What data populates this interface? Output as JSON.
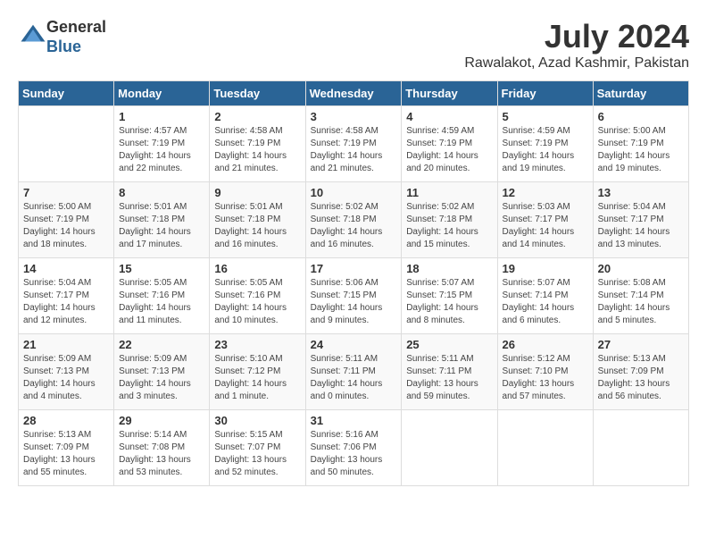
{
  "logo": {
    "general": "General",
    "blue": "Blue"
  },
  "title": "July 2024",
  "location": "Rawalakot, Azad Kashmir, Pakistan",
  "days_of_week": [
    "Sunday",
    "Monday",
    "Tuesday",
    "Wednesday",
    "Thursday",
    "Friday",
    "Saturday"
  ],
  "weeks": [
    [
      {
        "day": "",
        "info": ""
      },
      {
        "day": "1",
        "info": "Sunrise: 4:57 AM\nSunset: 7:19 PM\nDaylight: 14 hours\nand 22 minutes."
      },
      {
        "day": "2",
        "info": "Sunrise: 4:58 AM\nSunset: 7:19 PM\nDaylight: 14 hours\nand 21 minutes."
      },
      {
        "day": "3",
        "info": "Sunrise: 4:58 AM\nSunset: 7:19 PM\nDaylight: 14 hours\nand 21 minutes."
      },
      {
        "day": "4",
        "info": "Sunrise: 4:59 AM\nSunset: 7:19 PM\nDaylight: 14 hours\nand 20 minutes."
      },
      {
        "day": "5",
        "info": "Sunrise: 4:59 AM\nSunset: 7:19 PM\nDaylight: 14 hours\nand 19 minutes."
      },
      {
        "day": "6",
        "info": "Sunrise: 5:00 AM\nSunset: 7:19 PM\nDaylight: 14 hours\nand 19 minutes."
      }
    ],
    [
      {
        "day": "7",
        "info": "Sunrise: 5:00 AM\nSunset: 7:19 PM\nDaylight: 14 hours\nand 18 minutes."
      },
      {
        "day": "8",
        "info": "Sunrise: 5:01 AM\nSunset: 7:18 PM\nDaylight: 14 hours\nand 17 minutes."
      },
      {
        "day": "9",
        "info": "Sunrise: 5:01 AM\nSunset: 7:18 PM\nDaylight: 14 hours\nand 16 minutes."
      },
      {
        "day": "10",
        "info": "Sunrise: 5:02 AM\nSunset: 7:18 PM\nDaylight: 14 hours\nand 16 minutes."
      },
      {
        "day": "11",
        "info": "Sunrise: 5:02 AM\nSunset: 7:18 PM\nDaylight: 14 hours\nand 15 minutes."
      },
      {
        "day": "12",
        "info": "Sunrise: 5:03 AM\nSunset: 7:17 PM\nDaylight: 14 hours\nand 14 minutes."
      },
      {
        "day": "13",
        "info": "Sunrise: 5:04 AM\nSunset: 7:17 PM\nDaylight: 14 hours\nand 13 minutes."
      }
    ],
    [
      {
        "day": "14",
        "info": "Sunrise: 5:04 AM\nSunset: 7:17 PM\nDaylight: 14 hours\nand 12 minutes."
      },
      {
        "day": "15",
        "info": "Sunrise: 5:05 AM\nSunset: 7:16 PM\nDaylight: 14 hours\nand 11 minutes."
      },
      {
        "day": "16",
        "info": "Sunrise: 5:05 AM\nSunset: 7:16 PM\nDaylight: 14 hours\nand 10 minutes."
      },
      {
        "day": "17",
        "info": "Sunrise: 5:06 AM\nSunset: 7:15 PM\nDaylight: 14 hours\nand 9 minutes."
      },
      {
        "day": "18",
        "info": "Sunrise: 5:07 AM\nSunset: 7:15 PM\nDaylight: 14 hours\nand 8 minutes."
      },
      {
        "day": "19",
        "info": "Sunrise: 5:07 AM\nSunset: 7:14 PM\nDaylight: 14 hours\nand 6 minutes."
      },
      {
        "day": "20",
        "info": "Sunrise: 5:08 AM\nSunset: 7:14 PM\nDaylight: 14 hours\nand 5 minutes."
      }
    ],
    [
      {
        "day": "21",
        "info": "Sunrise: 5:09 AM\nSunset: 7:13 PM\nDaylight: 14 hours\nand 4 minutes."
      },
      {
        "day": "22",
        "info": "Sunrise: 5:09 AM\nSunset: 7:13 PM\nDaylight: 14 hours\nand 3 minutes."
      },
      {
        "day": "23",
        "info": "Sunrise: 5:10 AM\nSunset: 7:12 PM\nDaylight: 14 hours\nand 1 minute."
      },
      {
        "day": "24",
        "info": "Sunrise: 5:11 AM\nSunset: 7:11 PM\nDaylight: 14 hours\nand 0 minutes."
      },
      {
        "day": "25",
        "info": "Sunrise: 5:11 AM\nSunset: 7:11 PM\nDaylight: 13 hours\nand 59 minutes."
      },
      {
        "day": "26",
        "info": "Sunrise: 5:12 AM\nSunset: 7:10 PM\nDaylight: 13 hours\nand 57 minutes."
      },
      {
        "day": "27",
        "info": "Sunrise: 5:13 AM\nSunset: 7:09 PM\nDaylight: 13 hours\nand 56 minutes."
      }
    ],
    [
      {
        "day": "28",
        "info": "Sunrise: 5:13 AM\nSunset: 7:09 PM\nDaylight: 13 hours\nand 55 minutes."
      },
      {
        "day": "29",
        "info": "Sunrise: 5:14 AM\nSunset: 7:08 PM\nDaylight: 13 hours\nand 53 minutes."
      },
      {
        "day": "30",
        "info": "Sunrise: 5:15 AM\nSunset: 7:07 PM\nDaylight: 13 hours\nand 52 minutes."
      },
      {
        "day": "31",
        "info": "Sunrise: 5:16 AM\nSunset: 7:06 PM\nDaylight: 13 hours\nand 50 minutes."
      },
      {
        "day": "",
        "info": ""
      },
      {
        "day": "",
        "info": ""
      },
      {
        "day": "",
        "info": ""
      }
    ]
  ]
}
